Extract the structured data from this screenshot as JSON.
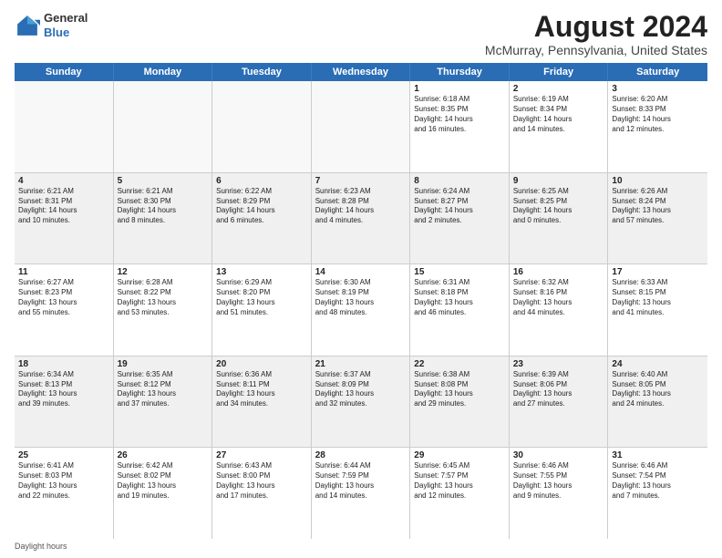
{
  "logo": {
    "general": "General",
    "blue": "Blue"
  },
  "title": "August 2024",
  "subtitle": "McMurray, Pennsylvania, United States",
  "weekdays": [
    "Sunday",
    "Monday",
    "Tuesday",
    "Wednesday",
    "Thursday",
    "Friday",
    "Saturday"
  ],
  "footer": "Daylight hours",
  "weeks": [
    [
      {
        "day": "",
        "text": "",
        "empty": true
      },
      {
        "day": "",
        "text": "",
        "empty": true
      },
      {
        "day": "",
        "text": "",
        "empty": true
      },
      {
        "day": "",
        "text": "",
        "empty": true
      },
      {
        "day": "1",
        "text": "Sunrise: 6:18 AM\nSunset: 8:35 PM\nDaylight: 14 hours\nand 16 minutes.",
        "empty": false
      },
      {
        "day": "2",
        "text": "Sunrise: 6:19 AM\nSunset: 8:34 PM\nDaylight: 14 hours\nand 14 minutes.",
        "empty": false
      },
      {
        "day": "3",
        "text": "Sunrise: 6:20 AM\nSunset: 8:33 PM\nDaylight: 14 hours\nand 12 minutes.",
        "empty": false
      }
    ],
    [
      {
        "day": "4",
        "text": "Sunrise: 6:21 AM\nSunset: 8:31 PM\nDaylight: 14 hours\nand 10 minutes.",
        "empty": false
      },
      {
        "day": "5",
        "text": "Sunrise: 6:21 AM\nSunset: 8:30 PM\nDaylight: 14 hours\nand 8 minutes.",
        "empty": false
      },
      {
        "day": "6",
        "text": "Sunrise: 6:22 AM\nSunset: 8:29 PM\nDaylight: 14 hours\nand 6 minutes.",
        "empty": false
      },
      {
        "day": "7",
        "text": "Sunrise: 6:23 AM\nSunset: 8:28 PM\nDaylight: 14 hours\nand 4 minutes.",
        "empty": false
      },
      {
        "day": "8",
        "text": "Sunrise: 6:24 AM\nSunset: 8:27 PM\nDaylight: 14 hours\nand 2 minutes.",
        "empty": false
      },
      {
        "day": "9",
        "text": "Sunrise: 6:25 AM\nSunset: 8:25 PM\nDaylight: 14 hours\nand 0 minutes.",
        "empty": false
      },
      {
        "day": "10",
        "text": "Sunrise: 6:26 AM\nSunset: 8:24 PM\nDaylight: 13 hours\nand 57 minutes.",
        "empty": false
      }
    ],
    [
      {
        "day": "11",
        "text": "Sunrise: 6:27 AM\nSunset: 8:23 PM\nDaylight: 13 hours\nand 55 minutes.",
        "empty": false
      },
      {
        "day": "12",
        "text": "Sunrise: 6:28 AM\nSunset: 8:22 PM\nDaylight: 13 hours\nand 53 minutes.",
        "empty": false
      },
      {
        "day": "13",
        "text": "Sunrise: 6:29 AM\nSunset: 8:20 PM\nDaylight: 13 hours\nand 51 minutes.",
        "empty": false
      },
      {
        "day": "14",
        "text": "Sunrise: 6:30 AM\nSunset: 8:19 PM\nDaylight: 13 hours\nand 48 minutes.",
        "empty": false
      },
      {
        "day": "15",
        "text": "Sunrise: 6:31 AM\nSunset: 8:18 PM\nDaylight: 13 hours\nand 46 minutes.",
        "empty": false
      },
      {
        "day": "16",
        "text": "Sunrise: 6:32 AM\nSunset: 8:16 PM\nDaylight: 13 hours\nand 44 minutes.",
        "empty": false
      },
      {
        "day": "17",
        "text": "Sunrise: 6:33 AM\nSunset: 8:15 PM\nDaylight: 13 hours\nand 41 minutes.",
        "empty": false
      }
    ],
    [
      {
        "day": "18",
        "text": "Sunrise: 6:34 AM\nSunset: 8:13 PM\nDaylight: 13 hours\nand 39 minutes.",
        "empty": false
      },
      {
        "day": "19",
        "text": "Sunrise: 6:35 AM\nSunset: 8:12 PM\nDaylight: 13 hours\nand 37 minutes.",
        "empty": false
      },
      {
        "day": "20",
        "text": "Sunrise: 6:36 AM\nSunset: 8:11 PM\nDaylight: 13 hours\nand 34 minutes.",
        "empty": false
      },
      {
        "day": "21",
        "text": "Sunrise: 6:37 AM\nSunset: 8:09 PM\nDaylight: 13 hours\nand 32 minutes.",
        "empty": false
      },
      {
        "day": "22",
        "text": "Sunrise: 6:38 AM\nSunset: 8:08 PM\nDaylight: 13 hours\nand 29 minutes.",
        "empty": false
      },
      {
        "day": "23",
        "text": "Sunrise: 6:39 AM\nSunset: 8:06 PM\nDaylight: 13 hours\nand 27 minutes.",
        "empty": false
      },
      {
        "day": "24",
        "text": "Sunrise: 6:40 AM\nSunset: 8:05 PM\nDaylight: 13 hours\nand 24 minutes.",
        "empty": false
      }
    ],
    [
      {
        "day": "25",
        "text": "Sunrise: 6:41 AM\nSunset: 8:03 PM\nDaylight: 13 hours\nand 22 minutes.",
        "empty": false
      },
      {
        "day": "26",
        "text": "Sunrise: 6:42 AM\nSunset: 8:02 PM\nDaylight: 13 hours\nand 19 minutes.",
        "empty": false
      },
      {
        "day": "27",
        "text": "Sunrise: 6:43 AM\nSunset: 8:00 PM\nDaylight: 13 hours\nand 17 minutes.",
        "empty": false
      },
      {
        "day": "28",
        "text": "Sunrise: 6:44 AM\nSunset: 7:59 PM\nDaylight: 13 hours\nand 14 minutes.",
        "empty": false
      },
      {
        "day": "29",
        "text": "Sunrise: 6:45 AM\nSunset: 7:57 PM\nDaylight: 13 hours\nand 12 minutes.",
        "empty": false
      },
      {
        "day": "30",
        "text": "Sunrise: 6:46 AM\nSunset: 7:55 PM\nDaylight: 13 hours\nand 9 minutes.",
        "empty": false
      },
      {
        "day": "31",
        "text": "Sunrise: 6:46 AM\nSunset: 7:54 PM\nDaylight: 13 hours\nand 7 minutes.",
        "empty": false
      }
    ]
  ]
}
